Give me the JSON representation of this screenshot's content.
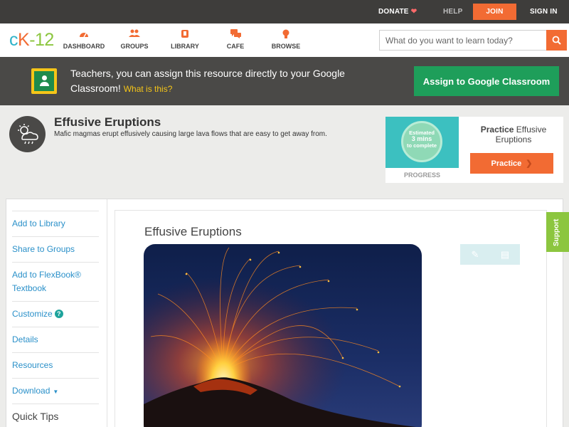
{
  "topbar": {
    "donate": "DONATE",
    "help": "HELP",
    "join": "JOIN",
    "sign_in": "SIGN IN"
  },
  "logo": {
    "c": "c",
    "k": "K",
    "n": "-12"
  },
  "nav": {
    "dashboard": "DASHBOARD",
    "groups": "GROUPS",
    "library": "LIBRARY",
    "cafe": "CAFE",
    "browse": "BROWSE"
  },
  "search": {
    "placeholder": "What do you want to learn today?"
  },
  "banner": {
    "text": "Teachers, you can assign this resource directly to your Google Classroom!",
    "link": "What is this?",
    "button": "Assign to Google Classroom"
  },
  "concept": {
    "title": "Effusive Eruptions",
    "description": "Mafic magmas erupt effusively causing large lava flows that are easy to get away from."
  },
  "practice_card": {
    "estimated_line1": "Estimated",
    "estimated_line2": "3 mins",
    "estimated_line3": "to complete",
    "progress_label": "PROGRESS",
    "heading_bold": "Practice",
    "heading_rest": "Effusive Eruptions",
    "button": "Practice"
  },
  "sidebar": {
    "items": [
      {
        "label": "Add to Library"
      },
      {
        "label": "Share to Groups"
      },
      {
        "label": "Add to FlexBook® Textbook"
      },
      {
        "label": "Customize"
      },
      {
        "label": "Details"
      },
      {
        "label": "Resources"
      },
      {
        "label": "Download"
      }
    ],
    "customize_badge": "?",
    "quick_tips": "Quick Tips"
  },
  "article": {
    "title": "Effusive Eruptions"
  },
  "support": "Support",
  "colors": {
    "accent_orange": "#f26b33",
    "classroom_green": "#1e9e5a",
    "link_blue": "#2a90c9",
    "support_green": "#8cc63f"
  }
}
